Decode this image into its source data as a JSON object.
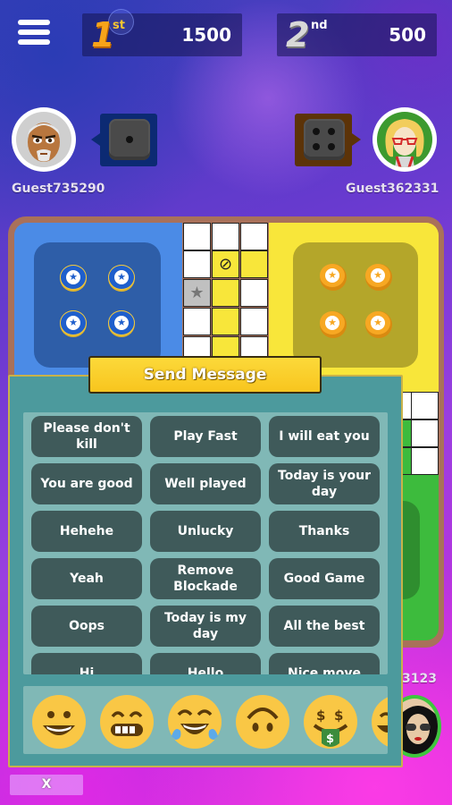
{
  "header": {
    "menu_icon": "hamburger-menu-icon",
    "ranks": [
      {
        "place": "1",
        "suffix": "st",
        "score": "1500"
      },
      {
        "place": "2",
        "suffix": "nd",
        "score": "500"
      }
    ]
  },
  "players": [
    {
      "name": "Guest735290",
      "color": "blue",
      "dice_value": 1,
      "avatar": "bald-man-avatar"
    },
    {
      "name": "Guest362331",
      "color": "yellow",
      "dice_value": 4,
      "avatar": "blonde-woman-glasses-avatar"
    },
    {
      "name": "3123",
      "color": "green",
      "avatar": "woman-sunglasses-avatar"
    }
  ],
  "board": {
    "colors": {
      "blue": "#4b8be6",
      "yellow": "#f8e63a",
      "green": "#3dbb3d",
      "frame": "#a9715a"
    },
    "blue_tokens_home": 4,
    "yellow_tokens_home": 4
  },
  "chat": {
    "title": "Send Message",
    "messages": [
      "Please don't kill",
      "Play Fast",
      "I will eat you",
      "You are good",
      "Well played",
      "Today is your day",
      "Hehehe",
      "Unlucky",
      "Thanks",
      "Yeah",
      "Remove Blockade",
      "Good Game",
      "Oops",
      "Today is my day",
      "All the best",
      "Hi",
      "Hello",
      "Nice move"
    ],
    "emojis": [
      "grinning-face",
      "grimacing-face",
      "tears-of-joy-face",
      "upside-down-face",
      "money-mouth-face",
      "partial-emoji"
    ],
    "close_label": "X"
  }
}
